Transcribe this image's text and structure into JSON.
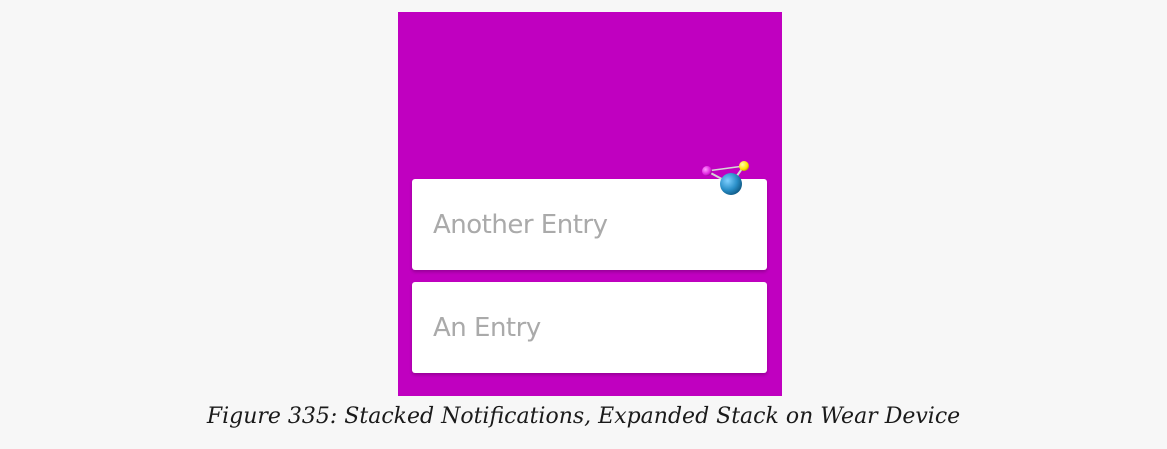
{
  "colors": {
    "page_background": "#f7f7f7",
    "wear_background": "#c000c0",
    "card_background": "#ffffff",
    "card_text": "#aaaaaa",
    "icon_pink": "#e020e0",
    "icon_yellow": "#ffe600",
    "icon_blue": "#2a8fc8"
  },
  "notifications": [
    {
      "text": "Another Entry",
      "icon": "molecule-app-icon"
    },
    {
      "text": "An Entry"
    }
  ],
  "caption": "Figure 335: Stacked Notifications, Expanded Stack on Wear Device"
}
